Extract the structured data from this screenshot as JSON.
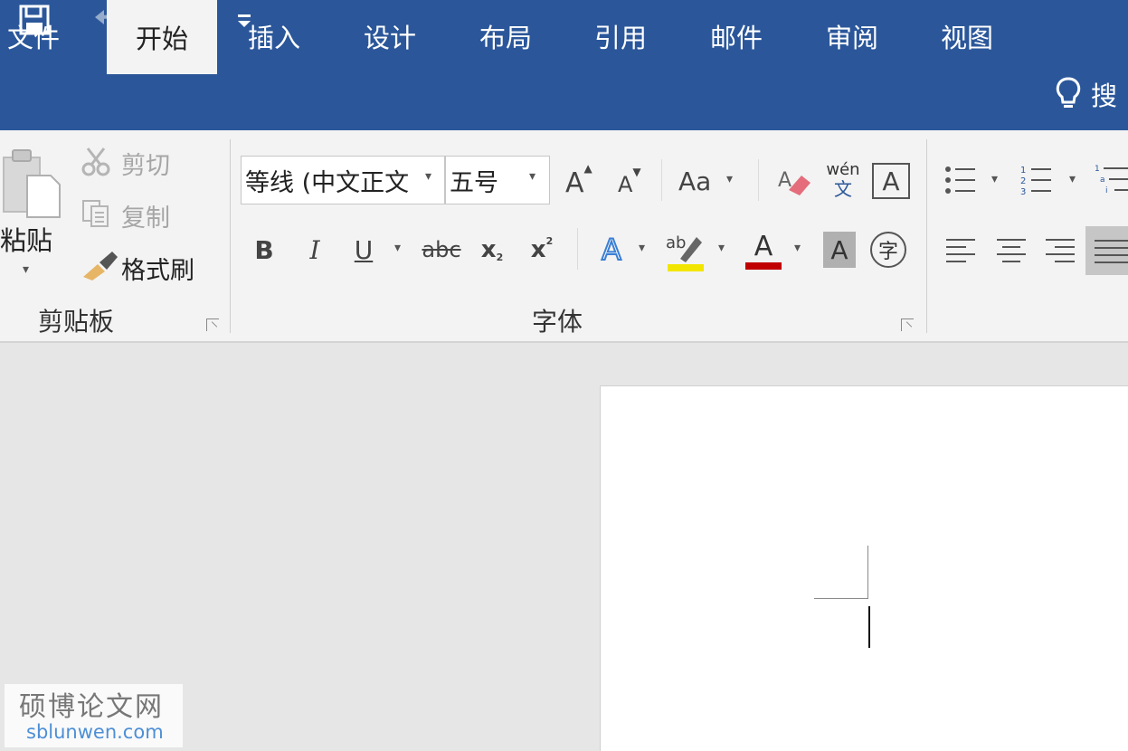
{
  "quick_access": {
    "save_icon": "save-icon",
    "undo_icon": "undo-icon",
    "redo_icon": "redo-icon",
    "customize_icon": "customize-qat-icon"
  },
  "tabs": [
    {
      "label": "文件"
    },
    {
      "label": "开始"
    },
    {
      "label": "插入"
    },
    {
      "label": "设计"
    },
    {
      "label": "布局"
    },
    {
      "label": "引用"
    },
    {
      "label": "邮件"
    },
    {
      "label": "审阅"
    },
    {
      "label": "视图"
    }
  ],
  "tell_me": {
    "label": "搜",
    "icon": "lightbulb-icon"
  },
  "clipboard": {
    "group_label": "剪贴板",
    "paste_label": "粘贴",
    "cut_label": "剪切",
    "copy_label": "复制",
    "format_painter_label": "格式刷"
  },
  "font": {
    "group_label": "字体",
    "font_name": "等线 (中文正文",
    "font_size": "五号",
    "grow_label": "A",
    "shrink_label": "A",
    "change_case_label": "Aa",
    "bold_label": "B",
    "italic_label": "I",
    "underline_label": "U",
    "strike_label": "abc",
    "subscript_label": "x",
    "superscript_label": "x",
    "text_effects_label": "A",
    "highlight_label": "ab",
    "font_color_label": "A",
    "shading_label": "A",
    "enclose_label": "字",
    "phonetic_top": "wén",
    "phonetic_bottom": "文",
    "border_label": "A",
    "highlight_color": "#f2e600",
    "font_color": "#c00000"
  },
  "watermark": {
    "title": "硕博论文网",
    "url": "sblunwen.com"
  },
  "colors": {
    "brand": "#2b579a",
    "ribbon": "#f3f3f3"
  }
}
